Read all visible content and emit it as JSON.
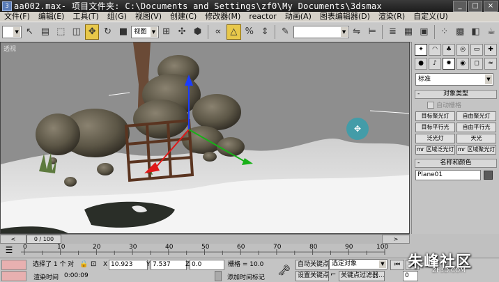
{
  "window": {
    "file": "aa002.max",
    "title": " - 项目文件夹: C:\\Documents and Settings\\zf0\\My Documents\\3dsmax",
    "icon": "3dsmax-icon"
  },
  "menu": [
    "文件(F)",
    "编辑(E)",
    "工具(T)",
    "组(G)",
    "视图(V)",
    "创建(C)",
    "修改器(M)",
    "reactor",
    "动画(A)",
    "图表编辑器(D)",
    "渲染(R)",
    "自定义(U)"
  ],
  "toolbar": {
    "selection_filter": "",
    "ref_coord": "视图",
    "named_selection": ""
  },
  "viewport": {
    "label": "透视"
  },
  "panel": {
    "category": "标准",
    "object_type_title": "对象类型",
    "autogrid": "自动栅格",
    "buttons": [
      "目标聚光灯",
      "自由聚光灯",
      "目标平行光",
      "自由平行光",
      "泛光灯",
      "天光",
      "mr 区域泛光灯",
      "mr 区域聚光灯"
    ],
    "name_color_title": "名称和颜色",
    "object_name": "Plane01",
    "object_color": "#5a5a5a"
  },
  "timeline": {
    "frame": "0 / 100",
    "ticks": [
      "0",
      "10",
      "20",
      "30",
      "40",
      "50",
      "60",
      "70",
      "80",
      "90",
      "100"
    ]
  },
  "status": {
    "selection": "选择了 1 个 对",
    "x_label": "X",
    "x": "10.923",
    "y_label": "Y",
    "y": "7.537",
    "z_label": "Z",
    "z": "0.0",
    "grid": "栅格 = 10.0",
    "autokey": "自动关键点",
    "key_filter": "选定对象",
    "set_key": "设置关键点",
    "key_filters": "关键点过滤器...",
    "render_time_label": "渲染时间",
    "render_time": "0:00:09",
    "add_time_tag": "添加时间标记",
    "frame_field": "0"
  },
  "watermark": {
    "text": "朱峰社区",
    "site": "ZF3D.COM"
  },
  "colors": {
    "accent_active": "#e8c84a",
    "viewport_bg": "#8c8c8c",
    "snow": "#ececec"
  }
}
